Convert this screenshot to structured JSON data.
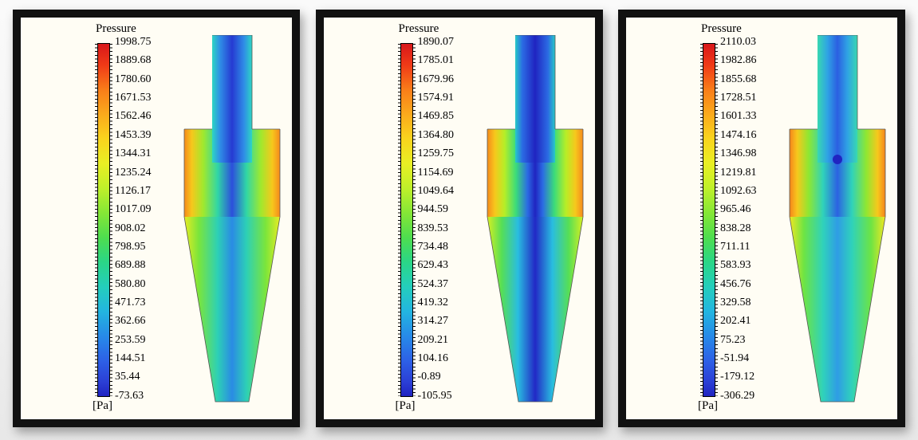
{
  "unit": "[Pa]",
  "panels": [
    {
      "title": "Pressure",
      "values": [
        1998.75,
        1889.68,
        1780.6,
        1671.53,
        1562.46,
        1453.39,
        1344.31,
        1235.24,
        1126.17,
        1017.09,
        908.02,
        798.95,
        689.88,
        580.8,
        471.73,
        362.66,
        253.59,
        144.51,
        35.44,
        -73.63
      ]
    },
    {
      "title": "Pressure",
      "values": [
        1890.07,
        1785.01,
        1679.96,
        1574.91,
        1469.85,
        1364.8,
        1259.75,
        1154.69,
        1049.64,
        944.59,
        839.53,
        734.48,
        629.43,
        524.37,
        419.32,
        314.27,
        209.21,
        104.16,
        -0.89,
        -105.95
      ]
    },
    {
      "title": "Pressure",
      "values": [
        2110.03,
        1982.86,
        1855.68,
        1728.51,
        1601.33,
        1474.16,
        1346.98,
        1219.81,
        1092.63,
        965.46,
        838.28,
        711.11,
        583.93,
        456.76,
        329.58,
        202.41,
        75.23,
        -51.94,
        -179.12,
        -306.29
      ]
    }
  ],
  "chart_data": [
    {
      "type": "heatmap",
      "title": "Pressure",
      "unit": "Pa",
      "colormap": "rainbow",
      "legend_levels": [
        1998.75,
        1889.68,
        1780.6,
        1671.53,
        1562.46,
        1453.39,
        1344.31,
        1235.24,
        1126.17,
        1017.09,
        908.02,
        798.95,
        689.88,
        580.8,
        471.73,
        362.66,
        253.59,
        144.51,
        35.44,
        -73.63
      ],
      "range": [
        -73.63,
        1998.75
      ],
      "geometry": "cyclone cross-section (outlet pipe + cylindrical body + conical lower section)",
      "qualitative_field": "high pressure (orange/red) at outer cylindrical walls, low pressure (blue) in central vortex core and outlet pipe"
    },
    {
      "type": "heatmap",
      "title": "Pressure",
      "unit": "Pa",
      "colormap": "rainbow",
      "legend_levels": [
        1890.07,
        1785.01,
        1679.96,
        1574.91,
        1469.85,
        1364.8,
        1259.75,
        1154.69,
        1049.64,
        944.59,
        839.53,
        734.48,
        629.43,
        524.37,
        419.32,
        314.27,
        209.21,
        104.16,
        -0.89,
        -105.95
      ],
      "range": [
        -105.95,
        1890.07
      ],
      "geometry": "cyclone cross-section (outlet pipe + cylindrical body + conical lower section)",
      "qualitative_field": "high pressure (orange/red) at outer cylindrical walls, pronounced low-pressure (dark blue) central core extending through cone"
    },
    {
      "type": "heatmap",
      "title": "Pressure",
      "unit": "Pa",
      "colormap": "rainbow",
      "legend_levels": [
        2110.03,
        1982.86,
        1855.68,
        1728.51,
        1601.33,
        1474.16,
        1346.98,
        1219.81,
        1092.63,
        965.46,
        838.28,
        711.11,
        583.93,
        456.76,
        329.58,
        202.41,
        75.23,
        -51.94,
        -179.12,
        -306.29
      ],
      "range": [
        -306.29,
        2110.03
      ],
      "geometry": "cyclone cross-section (outlet pipe + cylindrical body + conical lower section)",
      "qualitative_field": "highest wall pressure (orange) in upper body, blue/cyan core; localized dark-blue low-pressure spot at vortex finder tip"
    }
  ]
}
